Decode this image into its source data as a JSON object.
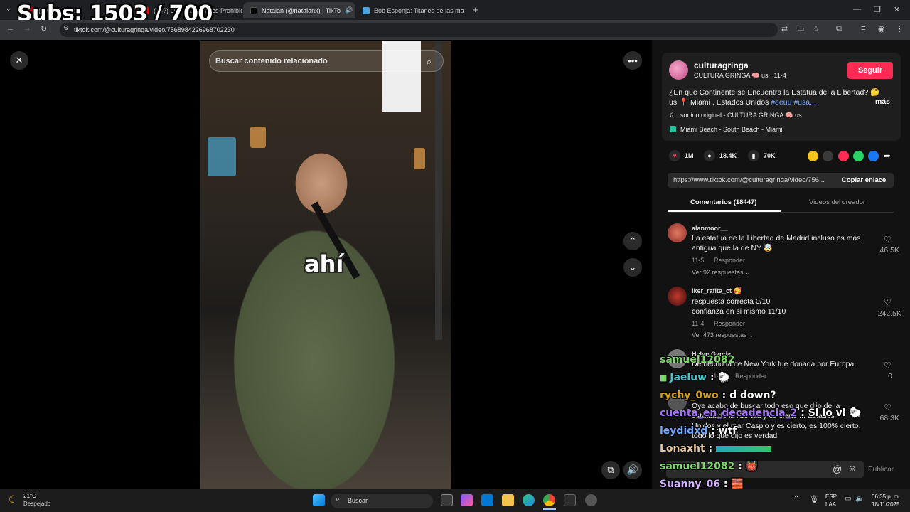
{
  "colors": {
    "accent": "#fe2c55",
    "hashtag": "#79a8ff",
    "panel_bg": "#121212"
  },
  "browser": {
    "tabs": [
      {
        "label": "(208) YouTube",
        "icon": "youtube-icon"
      },
      {
        "label": "(20?) Los Grabaciones Prohibid",
        "icon": "youtube-icon"
      },
      {
        "label": "Natalan (@natalanx) | TikTo",
        "icon": "tiktok-icon"
      },
      {
        "label": "Bob Esponja: Titanes de las ma",
        "icon": "game-icon"
      }
    ],
    "new_tab": "+",
    "url": "tiktok.com/@culturagringa/video/7568984226968702230"
  },
  "overlay": {
    "subs": "Subs: 1503 / 700"
  },
  "video": {
    "search_placeholder": "Buscar contenido relacionado",
    "caption": "ahí"
  },
  "post": {
    "author": "culturagringa",
    "author_sub": "CULTURA GRINGA 🧠 us · 11-4",
    "follow": "Seguir",
    "desc_line1": "¿En que Continente se Encuentra la Estatua de la Libertad? 🤔",
    "desc_line2_prefix": "us 📍 Miami , Estados Unidos ",
    "hashtag1": "#eeuu",
    "hashtag2": "#usa...",
    "more": "más",
    "sound": "sonido original - CULTURA GRINGA 🧠 us",
    "location": "Miami Beach - South Beach - Miami",
    "likes": "1M",
    "comments": "18.4K",
    "saves": "70K",
    "link": "https://www.tiktok.com/@culturagringa/video/756...",
    "copy_link": "Copiar enlace",
    "tab_comments": "Comentarios (18447)",
    "tab_videos": "Videos del creador"
  },
  "comments": [
    {
      "user": "alanmoor__",
      "line1": "La estatua de la Libertad de Madrid incluso es mas",
      "line2": "antigua que la de NY 🤯",
      "date": "11-5",
      "reply": "Responder",
      "replies": "Ver 92 respuestas ⌄",
      "likes": "46.5K"
    },
    {
      "user": "Iker_rafita_ct 🥰",
      "line1": "respuesta correcta 0/10",
      "line2": "confianza en si mismo 11/10",
      "date": "11-4",
      "reply": "Responder",
      "replies": "Ver 473 respuestas ⌄",
      "likes": "242.5K"
    },
    {
      "user": "Helen Garcia",
      "line1": "De hecho la de New York fue donada por Europa",
      "date": "11-?",
      "reply": "Responder",
      "likes": "0"
    },
    {
      "line1": "Oye acabo de buscar todo eso que dijo de la",
      "line2": "estatua de la libertad y es cierto ... Estados",
      "line3": "Unidos y el mar Caspio y es cierto, es 100% cierto,",
      "line4": "todo lo que dijo es verdad",
      "likes": "68.3K"
    }
  ],
  "comment_input": {
    "publish": "Publicar"
  },
  "chat": [
    {
      "user": "samuel12082",
      "color": "#7cd96a",
      "msg": ""
    },
    {
      "user": "Jaeluw",
      "color": "#4fc3d0",
      "msg": " : 🐑"
    },
    {
      "user": "rychy_0wo",
      "color": "#d4a017",
      "msg": " : d down?"
    },
    {
      "user": "cuenta_en_decadencia_2",
      "color": "#a772ff",
      "msg": " : Si lo vi 🐑"
    },
    {
      "user": "leydidxd",
      "color": "#6fa8ff",
      "msg": " : wtf"
    },
    {
      "user": "Lonaxht",
      "color": "#e8c9a0",
      "msg": " : "
    },
    {
      "user": "samuel12082",
      "color": "#7cd96a",
      "msg": " : 👹"
    },
    {
      "user": "Suanny_06",
      "color": "#d6b3ff",
      "msg": " : 🧱"
    }
  ],
  "taskbar": {
    "weather_temp": "21°C",
    "weather_desc": "Despejado",
    "search": "Buscar",
    "lang1": "ESP",
    "lang2": "LAA",
    "time": "06:35 p. m.",
    "date": "18/11/2025"
  }
}
